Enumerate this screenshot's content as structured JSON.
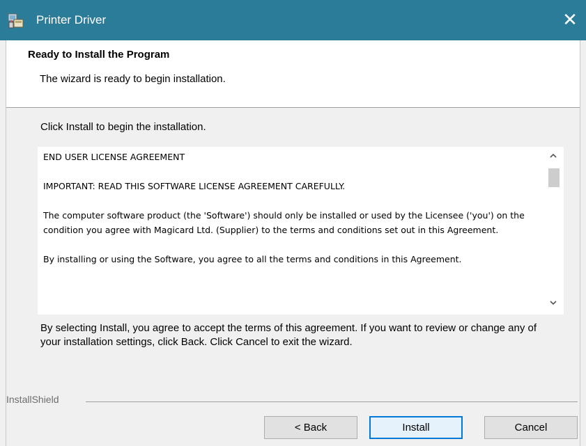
{
  "window": {
    "title": "Printer Driver",
    "close_symbol": "✕"
  },
  "header": {
    "title": "Ready to Install the Program",
    "subtitle": "The wizard is ready to begin installation."
  },
  "main": {
    "instruction": "Click Install to begin the installation.",
    "license": {
      "paragraphs": [
        "END USER LICENSE AGREEMENT",
        "IMPORTANT: READ THIS SOFTWARE LICENSE AGREEMENT CAREFULLY.",
        "The computer software product (the 'Software') should only be installed or used by the Licensee ('you') on the condition you agree with Magicard Ltd. (Supplier) to the terms and conditions set out in this Agreement.",
        "By installing or using the Software, you agree to all the terms and conditions in this Agreement."
      ]
    },
    "notice": "By selecting Install, you agree to accept the terms of this agreement. If you want to review or change any of your installation settings, click Back. Click Cancel to exit the wizard."
  },
  "footer": {
    "brand": "InstallShield",
    "back_label": "< Back",
    "install_label": "Install",
    "cancel_label": "Cancel"
  },
  "colors": {
    "titlebar": "#2b7c99",
    "focus_border": "#0078d7"
  },
  "icons": {
    "app": "installer-icon",
    "close": "close-icon",
    "scroll_up": "chevron-up-icon",
    "scroll_down": "chevron-down-icon"
  }
}
